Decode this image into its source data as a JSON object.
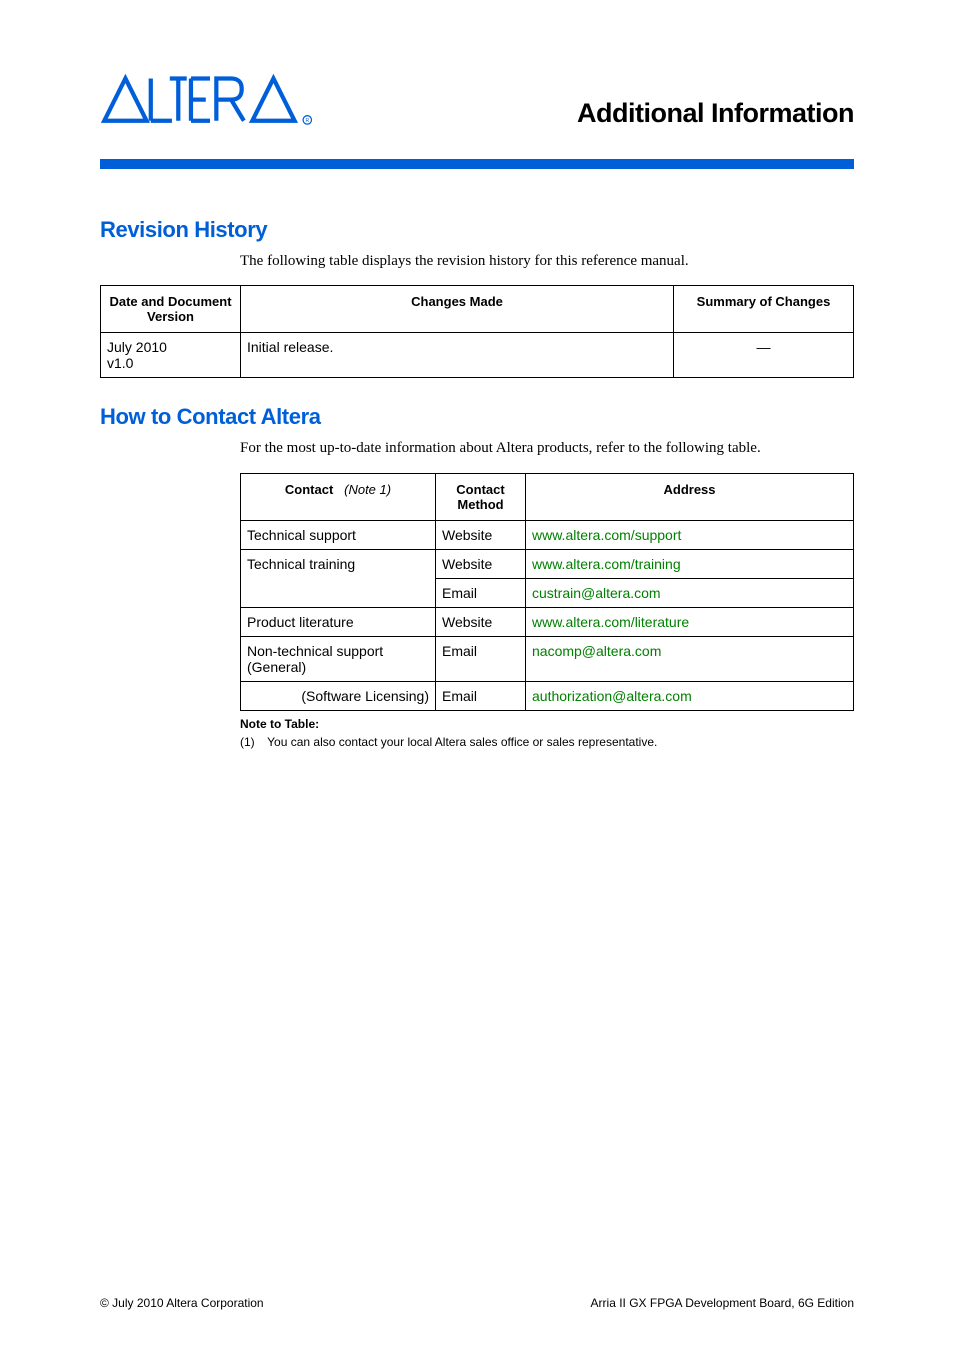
{
  "header": {
    "logo_alt": "Altera",
    "page_title": "Additional Information"
  },
  "sections": {
    "revision": {
      "heading": "Revision History",
      "intro": "The following table displays the revision history for this reference manual.",
      "headers": {
        "col1": "Date and Document Version",
        "col2": "Changes Made",
        "col3": "Summary of Changes"
      },
      "rows": [
        {
          "date": "July 2010",
          "version": "v1.0",
          "changes": "Initial release.",
          "summary": "—"
        }
      ]
    },
    "contact": {
      "heading": "How to Contact Altera",
      "intro": "For the most up-to-date information about Altera products, refer to the following table.",
      "headers": {
        "col1_label": "Contact",
        "col1_note": "(Note 1)",
        "col2": "Contact Method",
        "col3": "Address"
      },
      "rows": [
        {
          "contact": "Technical support",
          "align": "left",
          "rowspan": 1,
          "method": "Website",
          "address": "www.altera.com/support"
        },
        {
          "contact": "Technical training",
          "align": "left",
          "rowspan": 2,
          "method": "Website",
          "address": "www.altera.com/training"
        },
        {
          "contact": "",
          "align": "left",
          "rowspan": 0,
          "method": "Email",
          "address": "custrain@altera.com"
        },
        {
          "contact": "Product literature",
          "align": "left",
          "rowspan": 1,
          "method": "Website",
          "address": "www.altera.com/literature"
        },
        {
          "contact": "Non-technical support (General)",
          "align": "left",
          "rowspan": 1,
          "method": "Email",
          "address": "nacomp@altera.com"
        },
        {
          "contact": "(Software Licensing)",
          "align": "right",
          "rowspan": 1,
          "method": "Email",
          "address": "authorization@altera.com"
        }
      ],
      "note_head": "Note to Table:",
      "note_body_num": "(1)",
      "note_body_text": "You can also contact your local Altera sales office or sales representative."
    }
  },
  "footer": {
    "left": "© July 2010   Altera Corporation",
    "right": "Arria II GX FPGA Development Board, 6G Edition"
  }
}
